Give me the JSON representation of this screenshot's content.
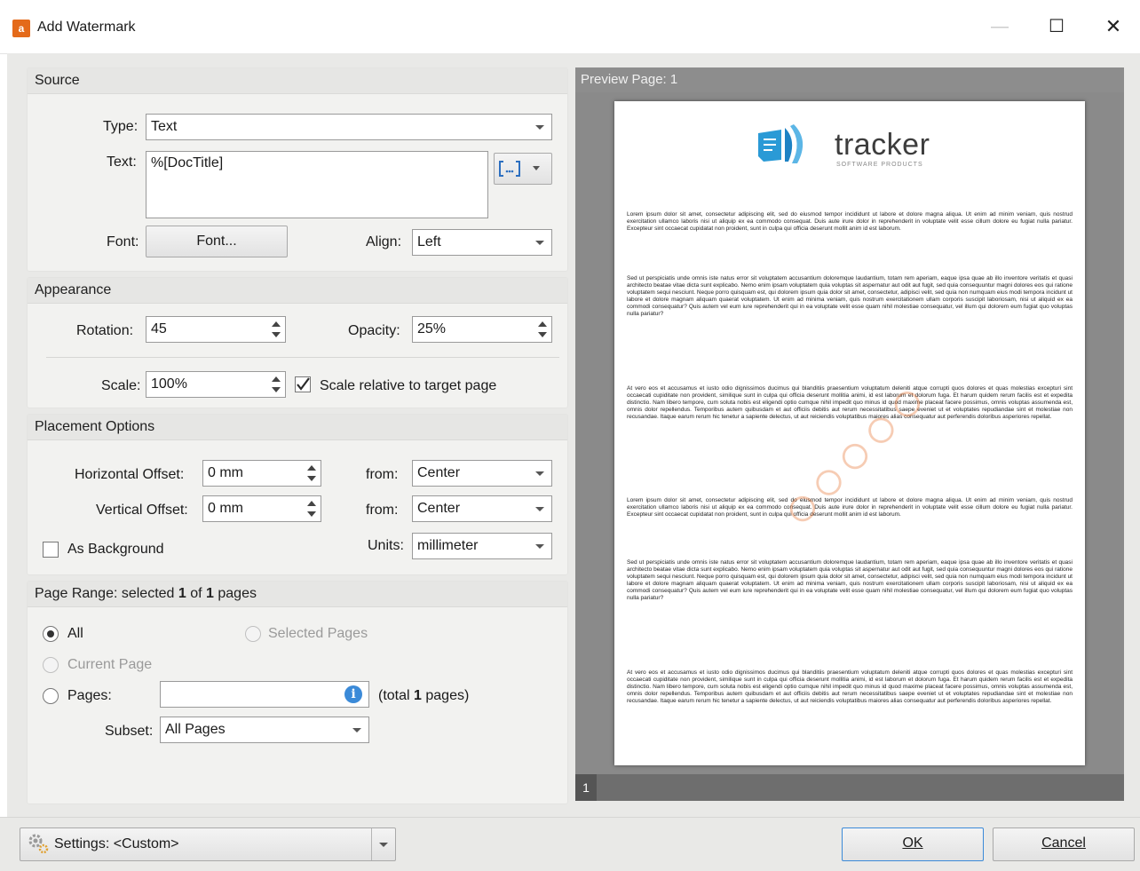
{
  "window": {
    "title": "Add Watermark",
    "app_icon_glyph": "a"
  },
  "source": {
    "heading": "Source",
    "type_label": "Type:",
    "type_value": "Text",
    "text_label": "Text:",
    "text_value": "%[DocTitle]",
    "font_label": "Font:",
    "font_button": "Font...",
    "align_label": "Align:",
    "align_value": "Left"
  },
  "appearance": {
    "heading": "Appearance",
    "rotation_label": "Rotation:",
    "rotation_value": "45",
    "opacity_label": "Opacity:",
    "opacity_value": "25%",
    "scale_label": "Scale:",
    "scale_value": "100%",
    "scale_relative_label": "Scale relative to target page",
    "scale_relative_checked": true
  },
  "placement": {
    "heading": "Placement Options",
    "h_offset_label": "Horizontal Offset:",
    "h_offset_value": "0 mm",
    "h_from_label": "from:",
    "h_from_value": "Center",
    "v_offset_label": "Vertical Offset:",
    "v_offset_value": "0 mm",
    "v_from_label": "from:",
    "v_from_value": "Center",
    "as_background_label": "As Background",
    "as_background_checked": false,
    "units_label": "Units:",
    "units_value": "millimeter"
  },
  "page_range": {
    "heading_prefix": "Page Range: selected ",
    "selected": "1",
    "heading_mid": " of ",
    "total": "1",
    "heading_suffix": " pages",
    "all_label": "All",
    "selected_pages_label": "Selected Pages",
    "current_page_label": "Current Page",
    "pages_label": "Pages:",
    "pages_value": "",
    "total_prefix": "(total ",
    "total_count": "1",
    "total_suffix": " pages)",
    "subset_label": "Subset:",
    "subset_value": "All Pages"
  },
  "preview": {
    "heading": "Preview Page: 1",
    "page_number": "1",
    "logo_text": "tracker",
    "logo_subtext": "SOFTWARE PRODUCTS",
    "paragraphs": [
      "Lorem ipsum dolor sit amet, consectetur adipiscing elit, sed do eiusmod tempor incididunt ut labore et dolore magna aliqua. Ut enim ad minim veniam, quis nostrud exercitation ullamco laboris nisi ut aliquip ex ea commodo consequat. Duis aute irure dolor in reprehenderit in voluptate velit esse cillum dolore eu fugiat nulla pariatur. Excepteur sint occaecat cupidatat non proident, sunt in culpa qui officia deserunt mollit anim id est laborum.",
      "Sed ut perspiciatis unde omnis iste natus error sit voluptatem accusantium doloremque laudantium, totam rem aperiam, eaque ipsa quae ab illo inventore veritatis et quasi architecto beatae vitae dicta sunt explicabo. Nemo enim ipsam voluptatem quia voluptas sit aspernatur aut odit aut fugit, sed quia consequuntur magni dolores eos qui ratione voluptatem sequi nesciunt. Neque porro quisquam est, qui dolorem ipsum quia dolor sit amet, consectetur, adipisci velit, sed quia non numquam eius modi tempora incidunt ut labore et dolore magnam aliquam quaerat voluptatem. Ut enim ad minima veniam, quis nostrum exercitationem ullam corporis suscipit laboriosam, nisi ut aliquid ex ea commodi consequatur? Quis autem vel eum iure reprehenderit qui in ea voluptate velit esse quam nihil molestiae consequatur, vel illum qui dolorem eum fugiat quo voluptas nulla pariatur?",
      "At vero eos et accusamus et iusto odio dignissimos ducimus qui blanditiis praesentium voluptatum deleniti atque corrupti quos dolores et quas molestias excepturi sint occaecati cupiditate non provident, similique sunt in culpa qui officia deserunt mollitia animi, id est laborum et dolorum fuga. Et harum quidem rerum facilis est et expedita distinctio. Nam libero tempore, cum soluta nobis est eligendi optio cumque nihil impedit quo minus id quod maxime placeat facere possimus, omnis voluptas assumenda est, omnis dolor repellendus. Temporibus autem quibusdam et aut officiis debitis aut rerum necessitatibus saepe eveniet ut et voluptates repudiandae sint et molestiae non recusandae. Itaque earum rerum hic tenetur a sapiente delectus, ut aut reiciendis voluptatibus maiores alias consequatur aut perferendis doloribus asperiores repellat.",
      "Lorem ipsum dolor sit amet, consectetur adipiscing elit, sed do eiusmod tempor incididunt ut labore et dolore magna aliqua. Ut enim ad minim veniam, quis nostrud exercitation ullamco laboris nisi ut aliquip ex ea commodo consequat. Duis aute irure dolor in reprehenderit in voluptate velit esse cillum dolore eu fugiat nulla pariatur. Excepteur sint occaecat cupidatat non proident, sunt in culpa qui officia deserunt mollit anim id est laborum.",
      "Sed ut perspiciatis unde omnis iste natus error sit voluptatem accusantium doloremque laudantium, totam rem aperiam, eaque ipsa quae ab illo inventore veritatis et quasi architecto beatae vitae dicta sunt explicabo. Nemo enim ipsam voluptatem quia voluptas sit aspernatur aut odit aut fugit, sed quia consequuntur magni dolores eos qui ratione voluptatem sequi nesciunt. Neque porro quisquam est, qui dolorem ipsum quia dolor sit amet, consectetur, adipisci velit, sed quia non numquam eius modi tempora incidunt ut labore et dolore magnam aliquam quaerat voluptatem. Ut enim ad minima veniam, quis nostrum exercitationem ullam corporis suscipit laboriosam, nisi ut aliquid ex ea commodi consequatur? Quis autem vel eum iure reprehenderit qui in ea voluptate velit esse quam nihil molestiae consequatur, vel illum qui dolorem eum fugiat quo voluptas nulla pariatur?",
      "At vero eos et accusamus et iusto odio dignissimos ducimus qui blanditiis praesentium voluptatum deleniti atque corrupti quos dolores et quas molestias excepturi sint occaecati cupiditate non provident, similique sunt in culpa qui officia deserunt mollitia animi, id est laborum et dolorum fuga. Et harum quidem rerum facilis est et expedita distinctio. Nam libero tempore, cum soluta nobis est eligendi optio cumque nihil impedit quo minus id quod maxime placeat facere possimus, omnis voluptas assumenda est, omnis dolor repellendus. Temporibus autem quibusdam et aut officiis debitis aut rerum necessitatibus saepe eveniet ut et voluptates repudiandae sint et molestiae non recusandae. Itaque earum rerum hic tenetur a sapiente delectus, ut aut reiciendis voluptatibus maiores alias consequatur aut perferendis doloribus asperiores repellat."
    ]
  },
  "footer": {
    "settings_label": "Settings: <Custom>",
    "ok_label": "OK",
    "cancel_label": "Cancel"
  },
  "colors": {
    "accent": "#3b8ad8",
    "watermark": "#e66e28",
    "app_icon": "#e46a1a"
  }
}
